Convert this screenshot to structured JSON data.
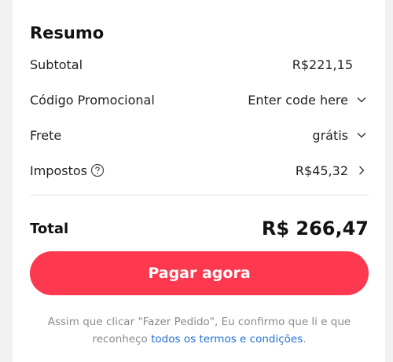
{
  "summary": {
    "title": "Resumo",
    "subtotal": {
      "label": "Subtotal",
      "value": "R$221,15"
    },
    "promo": {
      "label": "Código Promocional",
      "value": "Enter code here"
    },
    "shipping": {
      "label": "Frete",
      "value": "grátis"
    },
    "taxes": {
      "label": "Impostos",
      "value": "R$45,32"
    },
    "total": {
      "label": "Total",
      "value": "R$ 266,47"
    }
  },
  "actions": {
    "pay_label": "Pagar agora"
  },
  "disclaimer": {
    "text_before": "Assim que clicar \"Fazer Pedido\", Eu confirmo que li e que reconheço ",
    "link_text": "todos os termos e condições",
    "text_after": "."
  },
  "colors": {
    "accent": "#fd384f",
    "link": "#1f6ed4"
  },
  "icons": {
    "promo": "chevron-down-icon",
    "shipping": "chevron-down-icon",
    "taxes_info": "help-circle-icon",
    "taxes": "chevron-right-icon"
  }
}
